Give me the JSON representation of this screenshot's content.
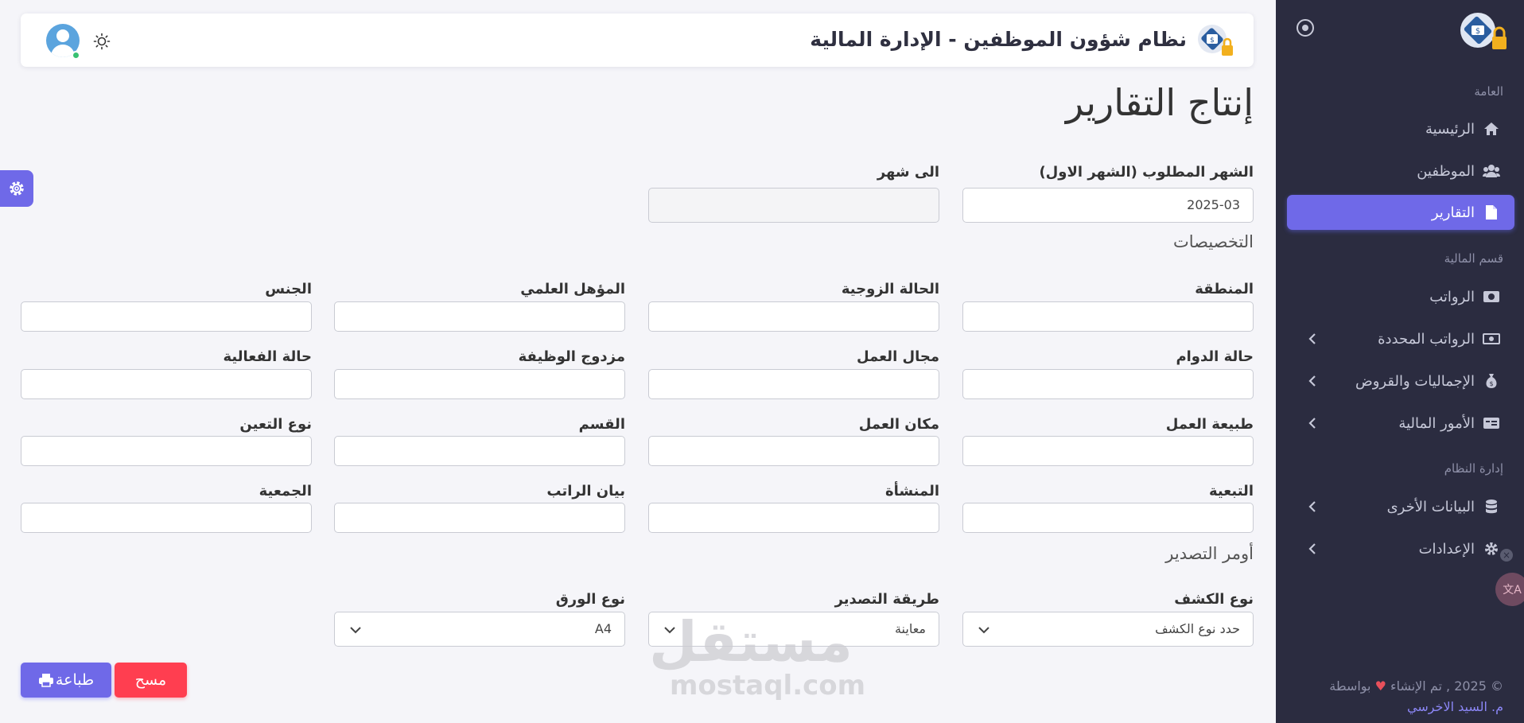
{
  "navbar": {
    "title": "نظام شؤون الموظفين - الإدارة المالية"
  },
  "sidebar": {
    "sections": {
      "general": "العامة",
      "finance": "قسم المالية",
      "system": "إدارة النظام"
    },
    "items": [
      {
        "label": "الرئيسية",
        "icon": "home-icon"
      },
      {
        "label": "الموظفين",
        "icon": "users-icon"
      },
      {
        "label": "التقارير",
        "icon": "file-icon",
        "active": true
      },
      {
        "label": "الرواتب",
        "icon": "money-icon"
      },
      {
        "label": "الرواتب المحددة",
        "icon": "cash-icon"
      },
      {
        "label": "الإجماليات والقروض",
        "icon": "money-bag-icon"
      },
      {
        "label": "الأمور المالية",
        "icon": "card-icon"
      },
      {
        "label": "البيانات الأخرى",
        "icon": "database-icon"
      },
      {
        "label": "الإعدادات",
        "icon": "gear-icon"
      }
    ],
    "footer": {
      "line1": "© 2025 , تم الإنشاء",
      "line1b": "بواسطة",
      "author": "م. السيد الاخرسي"
    }
  },
  "page": {
    "title": "إنتاج التقارير",
    "month_from_label": "الشهر المطلوب (الشهر الاول)",
    "month_from_value": "2025-03",
    "month_to_label": "الى شهر",
    "month_to_value": "",
    "specs_heading": "التخصيصات",
    "export_heading": "أومر التصدير"
  },
  "filters": [
    [
      "المنطقة",
      "الحالة الزوجية",
      "المؤهل العلمي",
      "الجنس"
    ],
    [
      "حالة الدوام",
      "مجال العمل",
      "مزدوج الوظيفة",
      "حالة الفعالية"
    ],
    [
      "طبيعة العمل",
      "مكان العمل",
      "القسم",
      "نوع التعين"
    ],
    [
      "التبعية",
      "المنشأة",
      "بيان الراتب",
      "الجمعية"
    ]
  ],
  "export": {
    "report_type_label": "نوع الكشف",
    "report_type_value": "حدد نوع الكشف",
    "method_label": "طريقة التصدير",
    "method_value": "معاينة",
    "paper_label": "نوع الورق",
    "paper_value": "A4"
  },
  "buttons": {
    "clear": "مسح",
    "print": "طباعة"
  },
  "watermark": {
    "arabic": "مستقل",
    "latin": "mostaql.com"
  },
  "colors": {
    "accent": "#6f69e8",
    "danger": "#ff3e50",
    "sidebar_bg": "#2b2c40",
    "page_bg": "#f5f5f9"
  }
}
